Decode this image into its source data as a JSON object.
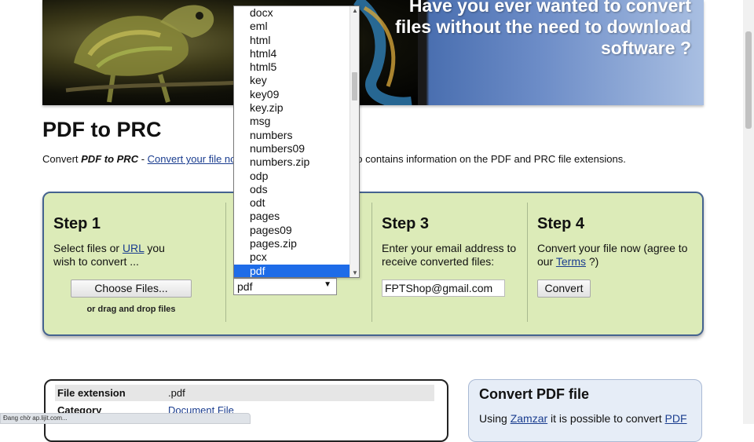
{
  "banner": {
    "headline": "Have you ever wanted to convert files without the need to download software ?"
  },
  "page": {
    "title": "PDF to PRC",
    "intro_prefix": "Convert ",
    "intro_bold": "PDF to PRC",
    "intro_dash": " - ",
    "intro_link": "Convert your file no",
    "intro_suffix": "age also contains information on the PDF and PRC file extensions."
  },
  "steps": {
    "step1": {
      "heading": "Step 1",
      "text_before": "Select files or ",
      "link": "URL",
      "text_after": " you wish to convert ...",
      "choose_button": "Choose Files...",
      "drag_note": "or drag and drop files"
    },
    "step2": {
      "selected_value": "pdf"
    },
    "step3": {
      "heading": "Step 3",
      "text": "Enter your email address to receive converted files:",
      "email_value": "FPTShop@gmail.com"
    },
    "step4": {
      "heading": "Step 4",
      "text_before": "Convert your file now (agree to our ",
      "link": "Terms",
      "text_after": " ?)",
      "convert_button": "Convert"
    }
  },
  "dropdown": {
    "options": [
      "docx",
      "eml",
      "html",
      "html4",
      "html5",
      "key",
      "key09",
      "key.zip",
      "msg",
      "numbers",
      "numbers09",
      "numbers.zip",
      "odp",
      "ods",
      "odt",
      "pages",
      "pages09",
      "pages.zip",
      "pcx",
      "pdf"
    ],
    "selected": "pdf"
  },
  "info": {
    "rows": [
      {
        "key": "File extension",
        "value": ".pdf"
      },
      {
        "key": "Category",
        "value": "Document File"
      }
    ]
  },
  "convert_box": {
    "title": "Convert PDF file",
    "text_before": "Using ",
    "link": "Zamzar",
    "text_mid": " it is possible to convert ",
    "link2": "PDF"
  },
  "status_bar": {
    "text": "Đang chờ ap.lijit.com..."
  }
}
